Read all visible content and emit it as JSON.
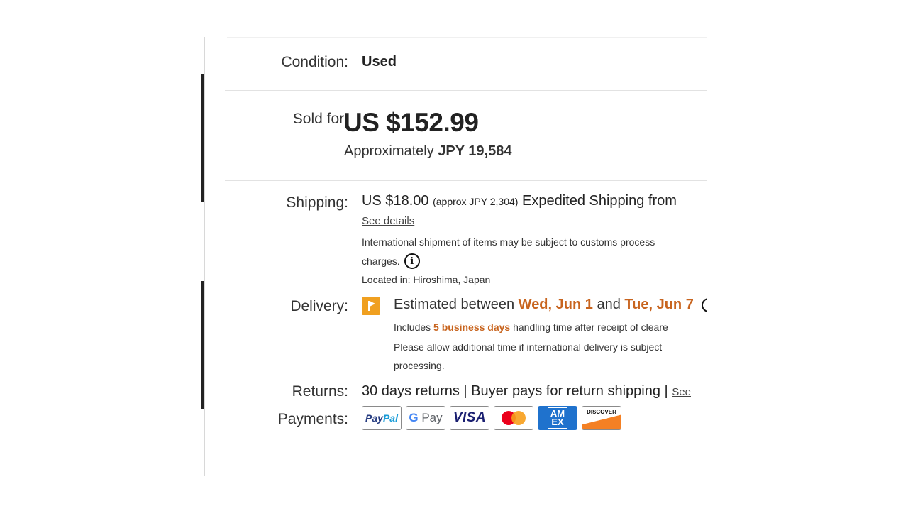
{
  "condition": {
    "label": "Condition:",
    "value": "Used"
  },
  "price": {
    "label": "Sold for:",
    "amount": "US $152.99",
    "approx_prefix": "Approximately",
    "approx_value": "JPY 19,584"
  },
  "shipping": {
    "label": "Shipping:",
    "cost": "US $18.00",
    "approx": "(approx JPY 2,304)",
    "method_text": "Expedited Shipping from",
    "see_details": "See details",
    "intl_line1": "International shipment of items may be subject to customs process",
    "intl_line2": "charges.",
    "info_icon": "i",
    "location": "Located in: Hiroshima, Japan"
  },
  "delivery": {
    "label": "Delivery:",
    "prefix": "Estimated between",
    "date_start": "Wed, Jun 1",
    "and": "and",
    "date_end": "Tue, Jun 7",
    "includes_prefix": "Includes",
    "business_days": "5 business days",
    "includes_suffix": "handling time after receipt of cleare",
    "allow_line1": "Please allow additional time if international delivery is subject",
    "allow_line2": "processing."
  },
  "returns": {
    "label": "Returns:",
    "text": "30 days returns | Buyer pays for return shipping |",
    "link": "See"
  },
  "payments": {
    "label": "Payments:",
    "methods": [
      {
        "name": "paypal",
        "text_a": "Pay",
        "text_b": "Pal"
      },
      {
        "name": "google-pay",
        "text_g": "G",
        "text_rest": "Pay"
      },
      {
        "name": "visa",
        "text": "VISA"
      },
      {
        "name": "mastercard"
      },
      {
        "name": "american-express",
        "text_top": "AM",
        "text_bottom": "EX"
      },
      {
        "name": "discover",
        "text": "DISCOVER"
      }
    ]
  },
  "colors": {
    "accent_orange": "#c8641e",
    "flag_orange": "#f0a020"
  }
}
